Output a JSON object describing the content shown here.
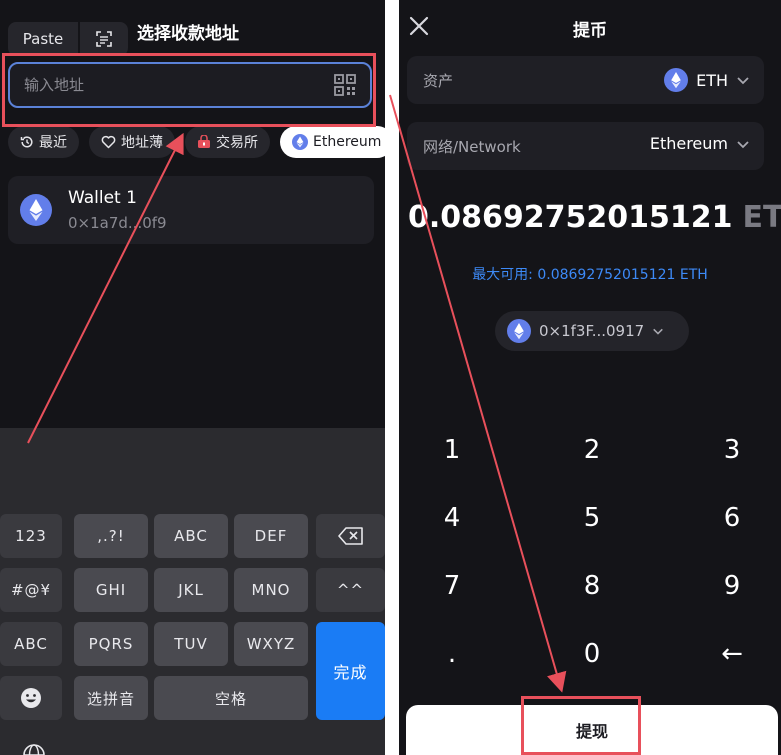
{
  "left": {
    "paste_label": "Paste",
    "title": "选择收款地址",
    "address_placeholder": "输入地址",
    "chips": [
      {
        "icon": "history-icon",
        "label": "最近"
      },
      {
        "icon": "heart-icon",
        "label": "地址薄"
      },
      {
        "icon": "exchange-icon",
        "label": "交易所"
      },
      {
        "icon": "ethereum-icon",
        "label": "Ethereum"
      }
    ],
    "wallet": {
      "name": "Wallet 1",
      "address": "0×1a7d...0f9"
    },
    "keyboard": {
      "k123": "123",
      "punct": ",.?!",
      "abc": "ABC",
      "def": "DEF",
      "sym": "#@¥",
      "ghi": "GHI",
      "jkl": "JKL",
      "mno": "MNO",
      "kaomoji": "^^",
      "abc2": "ABC",
      "pqrs": "PQRS",
      "tuv": "TUV",
      "wxyz": "WXYZ",
      "done": "完成",
      "pinyin": "选拼音",
      "space": "空格"
    }
  },
  "right": {
    "title": "提币",
    "asset_label": "资产",
    "asset_value": "ETH",
    "network_label": "网络/Network",
    "network_value": "Ethereum",
    "amount": "0.08692752015121",
    "amount_unit": "ETH",
    "max_available": "最大可用: 0.08692752015121 ETH",
    "from_address": "0×1f3F...0917",
    "numpad": [
      "1",
      "2",
      "3",
      "4",
      "5",
      "6",
      "7",
      "8",
      "9",
      ".",
      "0",
      "←"
    ],
    "withdraw_label": "提现"
  },
  "colors": {
    "accent_blue": "#3d8af7",
    "keyboard_done": "#1a7cf5",
    "annotation_red": "#e8505b",
    "ethereum": "#627eea"
  }
}
